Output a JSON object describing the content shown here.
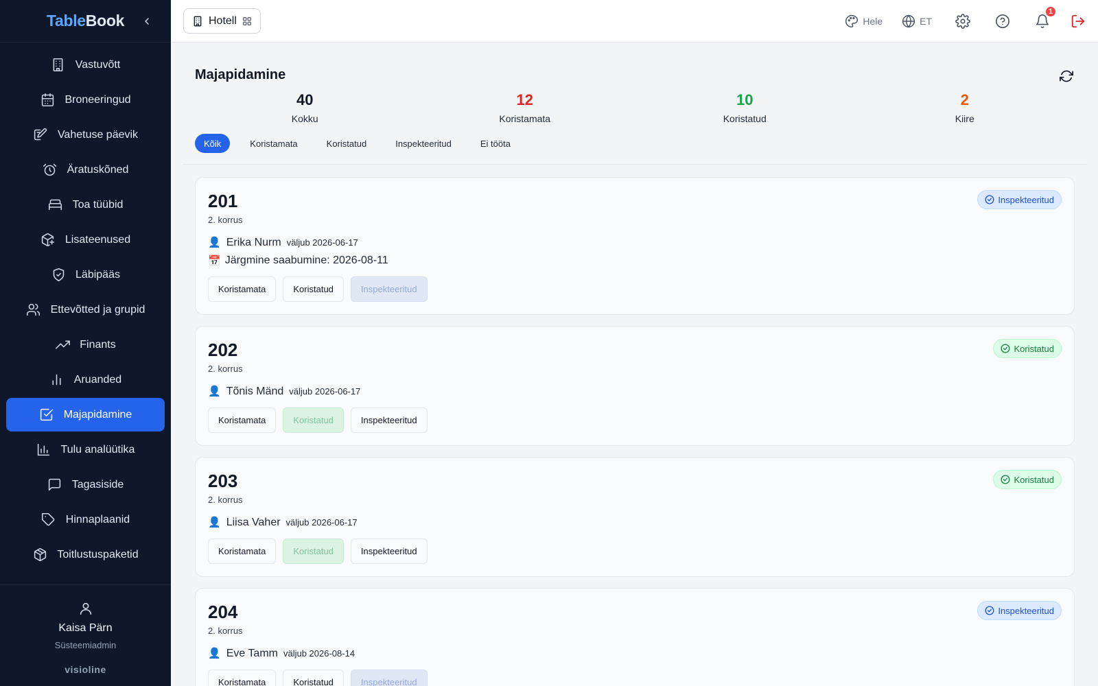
{
  "brand": {
    "part1": "Table",
    "part2": "Book"
  },
  "sidebar": {
    "items": [
      {
        "label": "Vastuvõtt",
        "icon": "building-icon"
      },
      {
        "label": "Broneeringud",
        "icon": "calendar-icon"
      },
      {
        "label": "Vahetuse päevik",
        "icon": "edit-note-icon"
      },
      {
        "label": "Äratuskõned",
        "icon": "alarm-icon"
      },
      {
        "label": "Toa tüübid",
        "icon": "bed-icon"
      },
      {
        "label": "Lisateenused",
        "icon": "package-plus-icon"
      },
      {
        "label": "Läbipääs",
        "icon": "shield-check-icon"
      },
      {
        "label": "Ettevõtted ja grupid",
        "icon": "users-icon"
      },
      {
        "label": "Finants",
        "icon": "trending-up-icon"
      },
      {
        "label": "Aruanded",
        "icon": "bar-chart-icon"
      },
      {
        "label": "Majapidamine",
        "icon": "check-square-icon",
        "active": true
      },
      {
        "label": "Tulu analüütika",
        "icon": "chart-icon"
      },
      {
        "label": "Tagasiside",
        "icon": "message-icon"
      },
      {
        "label": "Hinnaplaanid",
        "icon": "tag-icon"
      },
      {
        "label": "Toitlustuspaketid",
        "icon": "box-icon"
      }
    ],
    "user": {
      "name": "Kaisa Pärn",
      "role": "Süsteemiadmin"
    },
    "vendor": "visioline"
  },
  "topbar": {
    "hotel_label": "Hotell",
    "theme_label": "Hele",
    "language_label": "ET",
    "notification_count": "1"
  },
  "main": {
    "title": "Majapidamine",
    "stats": [
      {
        "value": "40",
        "label": "Kokku",
        "color": "#111827"
      },
      {
        "value": "12",
        "label": "Koristamata",
        "color": "#dc2626"
      },
      {
        "value": "10",
        "label": "Koristatud",
        "color": "#16a34a"
      },
      {
        "value": "2",
        "label": "Kiire",
        "color": "#ea580c"
      }
    ],
    "filters": [
      "Kõik",
      "Koristamata",
      "Koristatud",
      "Inspekteeritud",
      "Ei tööta"
    ],
    "rooms": [
      {
        "number": "201",
        "floor": "2. korrus",
        "guest": "Erika Nurm",
        "departs": "väljub 2026-06-17",
        "next_arrival": "Järgmine saabumine: 2026-08-11",
        "status": "Inspekteeritud",
        "status_kind": "insp"
      },
      {
        "number": "202",
        "floor": "2. korrus",
        "guest": "Tõnis Mänd",
        "departs": "väljub 2026-06-17",
        "next_arrival": "",
        "status": "Koristatud",
        "status_kind": "clean"
      },
      {
        "number": "203",
        "floor": "2. korrus",
        "guest": "Liisa Vaher",
        "departs": "väljub 2026-06-17",
        "next_arrival": "",
        "status": "Koristatud",
        "status_kind": "clean"
      },
      {
        "number": "204",
        "floor": "2. korrus",
        "guest": "Eve Tamm",
        "departs": "väljub 2026-08-14",
        "next_arrival": "",
        "status": "Inspekteeritud",
        "status_kind": "insp"
      }
    ],
    "action_labels": {
      "unclean": "Koristamata",
      "clean": "Koristatud",
      "inspected": "Inspekteeritud"
    },
    "guest_emoji": "👤",
    "arrival_emoji": "📅"
  }
}
